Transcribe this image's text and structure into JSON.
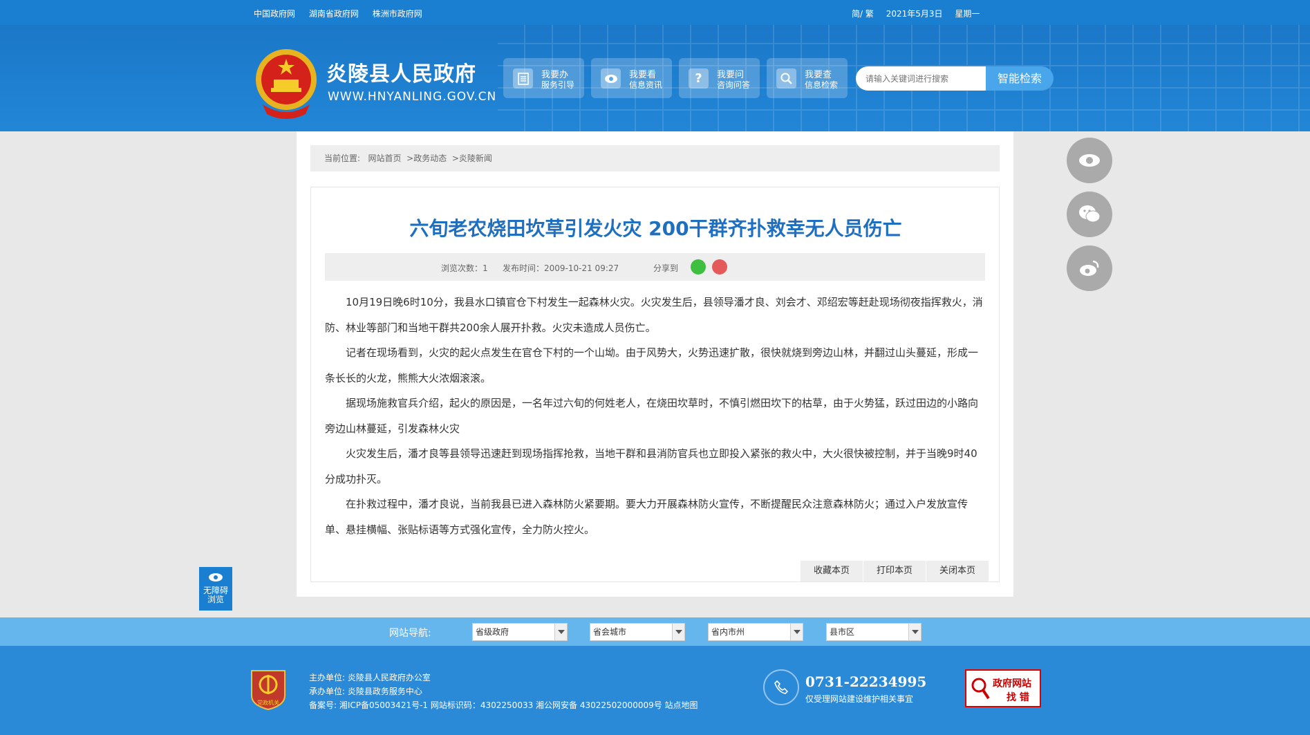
{
  "topbar": {
    "links": [
      "中国政府网",
      "湖南省政府网",
      "株洲市政府网"
    ],
    "lang": "简/ 繁",
    "date": "2021年5月3日",
    "weekday": "星期一"
  },
  "header": {
    "site_name": "炎陵县人民政府",
    "domain": "WWW.HNYANLING.GOV.CN",
    "buttons": [
      {
        "t1": "我要办",
        "t2": "服务引导",
        "icon": "document-icon"
      },
      {
        "t1": "我要看",
        "t2": "信息资讯",
        "icon": "eye-icon"
      },
      {
        "t1": "我要问",
        "t2": "咨询问答",
        "icon": "question-icon"
      },
      {
        "t1": "我要查",
        "t2": "信息检索",
        "icon": "search-icon"
      }
    ],
    "search_placeholder": "请输入关键词进行搜索",
    "search_button": "智能检索"
  },
  "breadcrumb": {
    "prefix": "当前位置:",
    "items": [
      "网站首页",
      ">政务动态",
      ">炎陵新闻"
    ]
  },
  "article": {
    "title": "六旬老农烧田坎草引发火灾 200干群齐扑救幸无人员伤亡",
    "views": "浏览次数：1",
    "date": "发布时间：2009-10-21 09:27",
    "share": "分享到",
    "paragraphs": [
      "10月19日晚6时10分，我县水口镇官仓下村发生一起森林火灾。火灾发生后，县领导潘才良、刘会才、邓绍宏等赶赴现场彻夜指挥救火，消防、林业等部门和当地干群共200余人展开扑救。火灾未造成人员伤亡。",
      "记者在现场看到，火灾的起火点发生在官仓下村的一个山坳。由于风势大，火势迅速扩散，很快就烧到旁边山林，并翻过山头蔓延，形成一条长长的火龙，熊熊大火浓烟滚滚。",
      "据现场施救官兵介绍，起火的原因是，一名年过六旬的何姓老人，在烧田坎草时，不慎引燃田坎下的枯草，由于火势猛，跃过田边的小路向旁边山林蔓延，引发森林火灾",
      "火灾发生后，潘才良等县领导迅速赶到现场指挥抢救，当地干群和县消防官兵也立即投入紧张的救火中，大火很快被控制，并于当晚9时40分成功扑灭。",
      "在扑救过程中，潘才良说，当前我县已进入森林防火紧要期。要大力开展森林防火宣传，不断提醒民众注意森林防火；通过入户发放宣传单、悬挂横幅、张贴标语等方式强化宣传，全力防火控火。"
    ],
    "actions": [
      "收藏本页",
      "打印本页",
      "关闭本页"
    ]
  },
  "a11y": {
    "line1": "无障碍",
    "line2": "浏览"
  },
  "nav": {
    "label": "网站导航:",
    "selects": [
      "省级政府",
      "省会城市",
      "省内市州",
      "县市区"
    ]
  },
  "footer": {
    "sponsor": "主办单位:  炎陵县人民政府办公室",
    "organizer": "承办单位:  炎陵县政务服务中心",
    "record": "备案号:  湘ICP备05003421号-1 网站标识码：4302250033 湘公网安备 43022502000009号 站点地图",
    "phone": "0731-22234995",
    "phone_note": "仅受理网站建设维护相关事宜",
    "err_t1": "政府网站",
    "err_t2": "找 错",
    "party_label": "党政机关"
  },
  "colors": {
    "brand": "#1a7fd0",
    "title": "#1e6fbf",
    "nav": "#66b6ee",
    "footer": "#2a8ad8"
  }
}
